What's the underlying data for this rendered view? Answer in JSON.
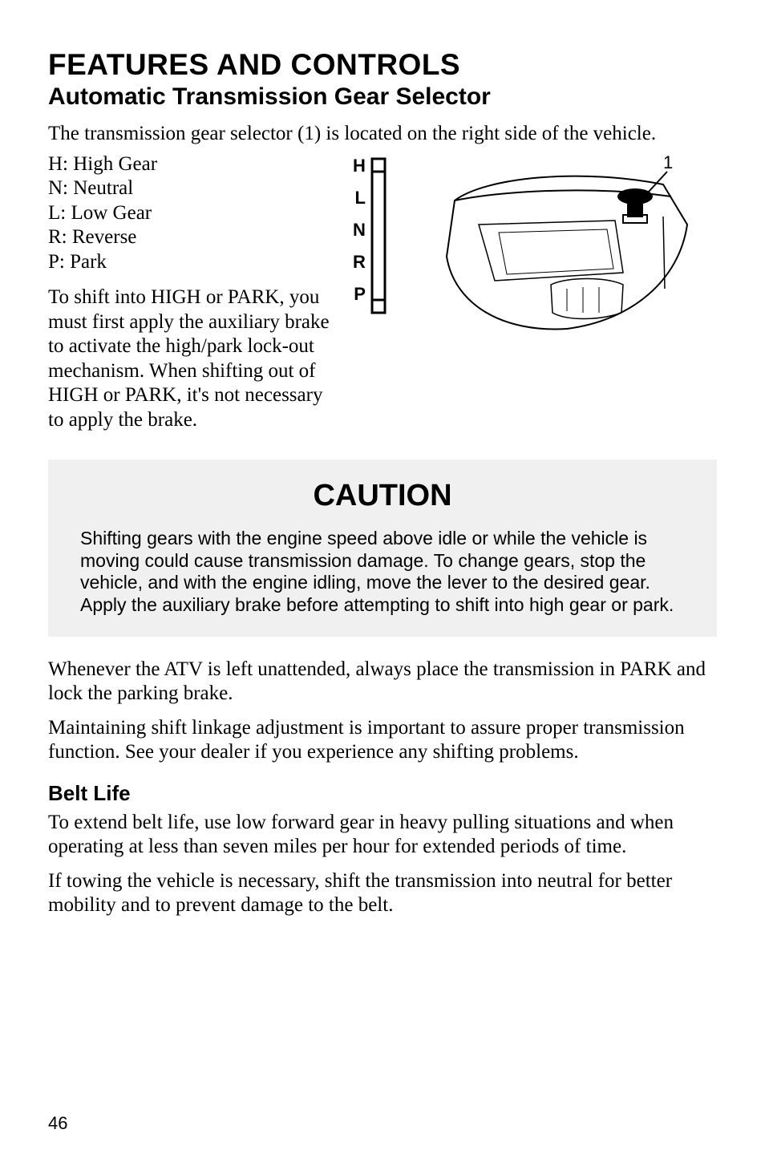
{
  "title": "FEATURES AND CONTROLS",
  "subtitle": "Automatic Transmission Gear Selector",
  "intro": "The transmission gear selector (1) is located on the right side of the vehicle.",
  "gear_list": {
    "H": "H: High Gear",
    "N": "N: Neutral",
    "L": "L:  Low Gear",
    "R": "R: Reverse",
    "P": "P:  Park"
  },
  "gear_letters": {
    "H": "H",
    "L": "L",
    "N": "N",
    "R": "R",
    "P": "P"
  },
  "callout": "1",
  "shift_note": "To shift into HIGH or PARK, you must first apply the auxiliary brake to activate the high/park lock-out mechanism. When shifting out of HIGH or PARK, it's not necessary to apply the brake.",
  "caution_title": "CAUTION",
  "caution_body": "Shifting gears with the engine speed above idle or while the vehicle is moving could cause transmission damage.  To change gears, stop the vehicle, and with the engine idling, move the lever to the desired gear.  Apply the auxiliary brake before attempting to shift into high gear or park.",
  "after1": "Whenever the ATV is left unattended, always place the transmission in PARK and lock the parking brake.",
  "after2": "Maintaining shift linkage adjustment is important to assure proper transmission function.  See your dealer if you experience any shifting problems.",
  "belt_title": "Belt Life",
  "belt1": "To extend belt life, use low forward gear in heavy pulling situations and when operating at less than seven miles per hour for extended periods of time.",
  "belt2": "If towing the vehicle is necessary, shift the transmission into neutral for better mobility and to prevent damage to the belt.",
  "page": "46"
}
